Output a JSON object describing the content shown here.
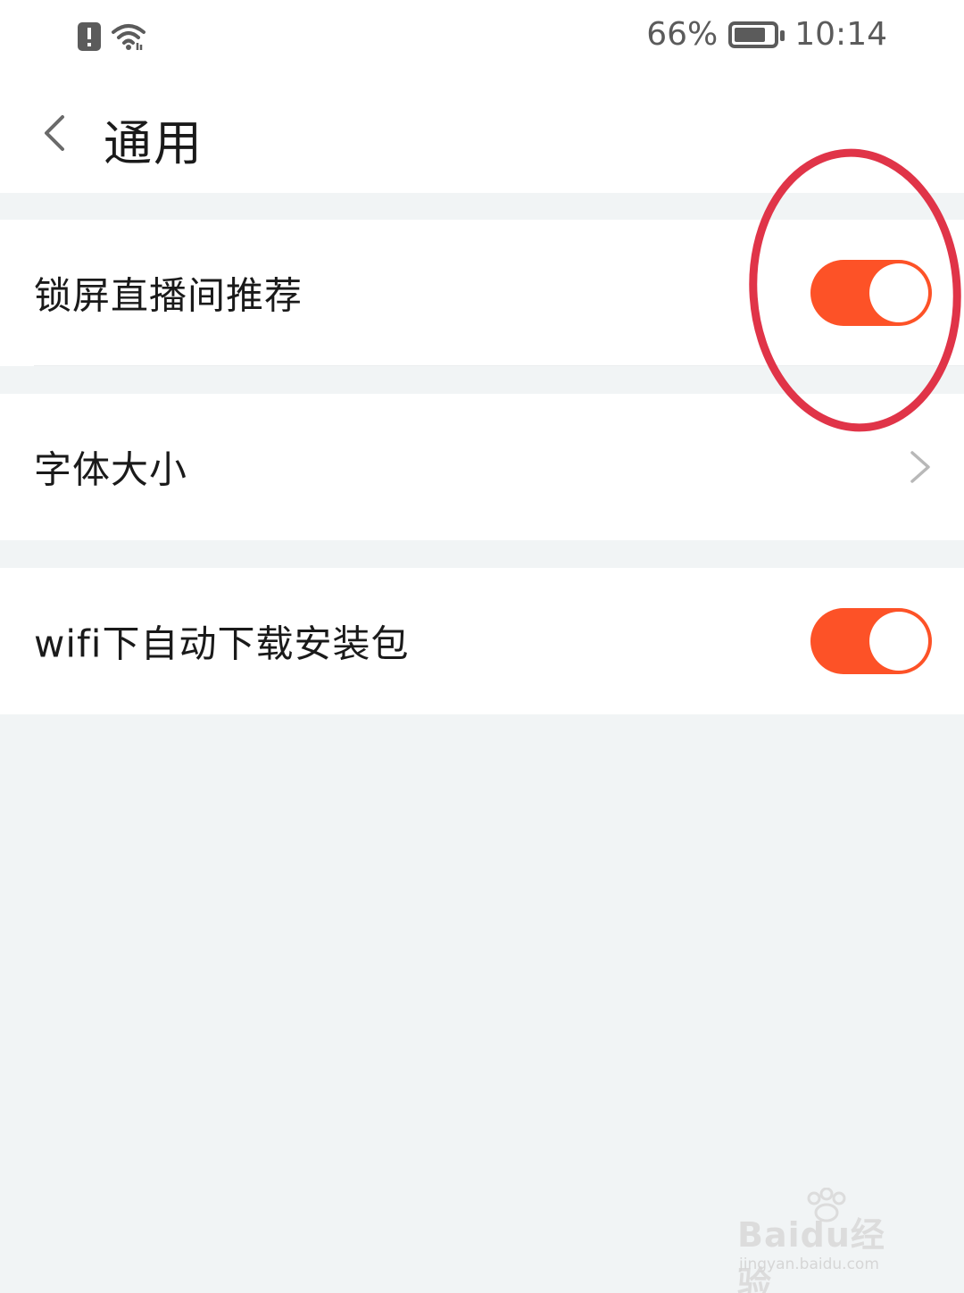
{
  "status_bar": {
    "battery_percent": "66%",
    "time": "10:14",
    "icons": [
      "alert-icon",
      "wifi-icon",
      "battery-icon"
    ]
  },
  "header": {
    "title": "通用",
    "back_icon": "chevron-left-icon"
  },
  "settings": [
    {
      "label": "锁屏直播间推荐",
      "control": "toggle",
      "enabled": true
    },
    {
      "label": "字体大小",
      "control": "chevron"
    },
    {
      "label": "wifi下自动下载安装包",
      "control": "toggle",
      "enabled": true
    }
  ],
  "watermark": {
    "main": "Baidu经验",
    "sub": "jingyan.baidu.com"
  },
  "colors": {
    "accent": "#fd5227",
    "annotation": "#e03448",
    "background": "#f1f4f5"
  }
}
